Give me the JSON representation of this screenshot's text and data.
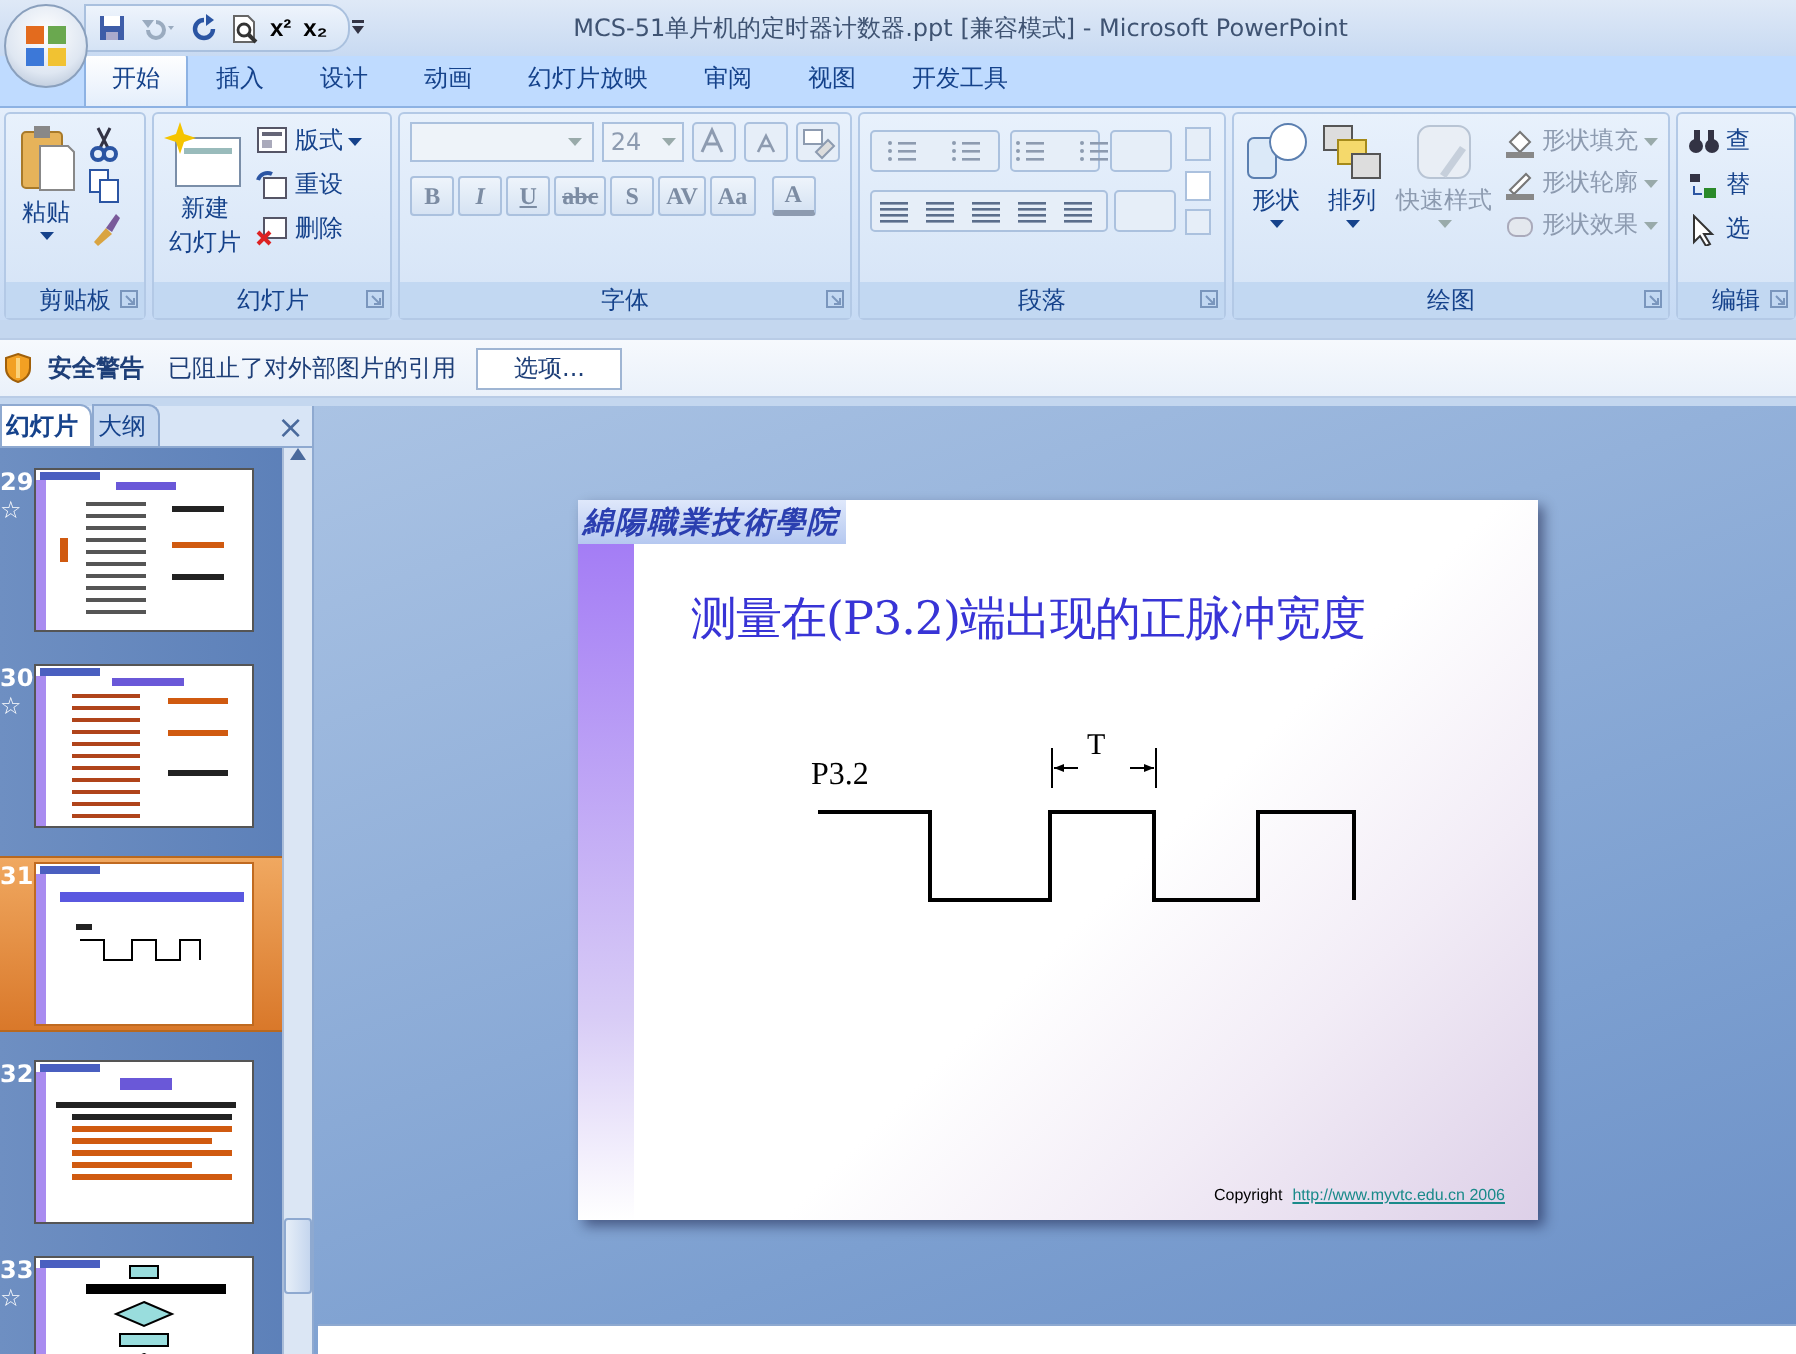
{
  "window": {
    "title": "MCS-51单片机的定时器计数器.ppt [兼容模式] - Microsoft PowerPoint",
    "superscript": "x²",
    "subscript": "x₂"
  },
  "tabs": [
    {
      "label": "开始",
      "selected": true
    },
    {
      "label": "插入",
      "selected": false
    },
    {
      "label": "设计",
      "selected": false
    },
    {
      "label": "动画",
      "selected": false
    },
    {
      "label": "幻灯片放映",
      "selected": false
    },
    {
      "label": "审阅",
      "selected": false
    },
    {
      "label": "视图",
      "selected": false
    },
    {
      "label": "开发工具",
      "selected": false
    }
  ],
  "ribbon": {
    "clipboard": {
      "title": "剪贴板",
      "paste": "粘贴"
    },
    "slides": {
      "title": "幻灯片",
      "new_slide": [
        "新建",
        "幻灯片"
      ],
      "layout": "版式",
      "reset": "重设",
      "delete": "删除"
    },
    "font": {
      "title": "字体",
      "size": "24",
      "buttons": [
        "B",
        "I",
        "U",
        "abc",
        "S",
        "AV",
        "Aa",
        "A"
      ]
    },
    "paragraph": {
      "title": "段落"
    },
    "drawing": {
      "title": "绘图",
      "items": [
        {
          "label": "形状",
          "disabled": false
        },
        {
          "label": "排列",
          "disabled": false
        },
        {
          "label": "快速样式",
          "disabled": true
        }
      ],
      "menu": [
        {
          "label": "形状填充",
          "disabled": true
        },
        {
          "label": "形状轮廓",
          "disabled": true
        },
        {
          "label": "形状效果",
          "disabled": true
        }
      ]
    },
    "editing": {
      "title": "编辑",
      "items": [
        "查",
        "替",
        "选"
      ]
    }
  },
  "security_bar": {
    "title": "安全警告",
    "message": "已阻止了对外部图片的引用",
    "button": "选项..."
  },
  "panel": {
    "tabs": [
      {
        "label": "幻灯片",
        "selected": true
      },
      {
        "label": "大纲",
        "selected": false
      }
    ],
    "close": "×",
    "slides": [
      {
        "number": "29",
        "mark": "☆",
        "selected": false
      },
      {
        "number": "30",
        "mark": "☆",
        "selected": false
      },
      {
        "number": "31",
        "selected": true
      },
      {
        "number": "32",
        "selected": false
      },
      {
        "number": "33",
        "mark": "☆",
        "selected": false
      }
    ]
  },
  "slide": {
    "logo": "綿陽職業技術學院",
    "title": "测量在(P3.2)端出现的正脉冲宽度",
    "signal_label": "P3.2",
    "period_label": "T",
    "copyright": "Copyright",
    "link": "http://www.myvtc.edu.cn  2006"
  }
}
